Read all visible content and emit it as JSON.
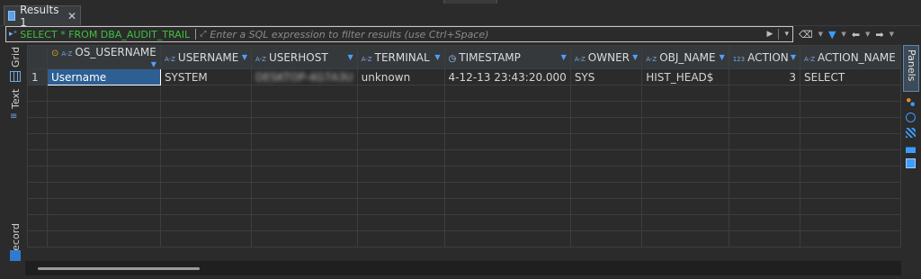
{
  "tab": {
    "label": "Results 1",
    "close": "✕"
  },
  "filter": {
    "sql": "SELECT * FROM DBA_AUDIT_TRAIL",
    "placeholder": "Enter a SQL expression to filter results (use Ctrl+Space)"
  },
  "sidebar": {
    "grid_label": "Grid",
    "text_label": "Text",
    "record_label": "Record"
  },
  "right_panel": {
    "panels_label": "Panels"
  },
  "columns": [
    {
      "name": "OS_USERNAME",
      "type_badge": "A-Z",
      "icon": "key-icon"
    },
    {
      "name": "USERNAME",
      "type_badge": "A-Z"
    },
    {
      "name": "USERHOST",
      "type_badge": "A-Z"
    },
    {
      "name": "TERMINAL",
      "type_badge": "A-Z"
    },
    {
      "name": "TIMESTAMP",
      "type_badge": "",
      "icon": "clock-icon"
    },
    {
      "name": "OWNER",
      "type_badge": "A-Z"
    },
    {
      "name": "OBJ_NAME",
      "type_badge": "A-Z"
    },
    {
      "name": "ACTION",
      "type_badge": "123"
    },
    {
      "name": "ACTION_NAME",
      "type_badge": "A-Z"
    }
  ],
  "rows": [
    {
      "row_number": "1",
      "cells": [
        "Username",
        "SYSTEM",
        "DESKTOP-4G7A3U",
        "unknown",
        "4-12-13 23:43:20.000",
        "SYS",
        "HIST_HEAD$",
        "3",
        "SELECT"
      ]
    }
  ]
}
